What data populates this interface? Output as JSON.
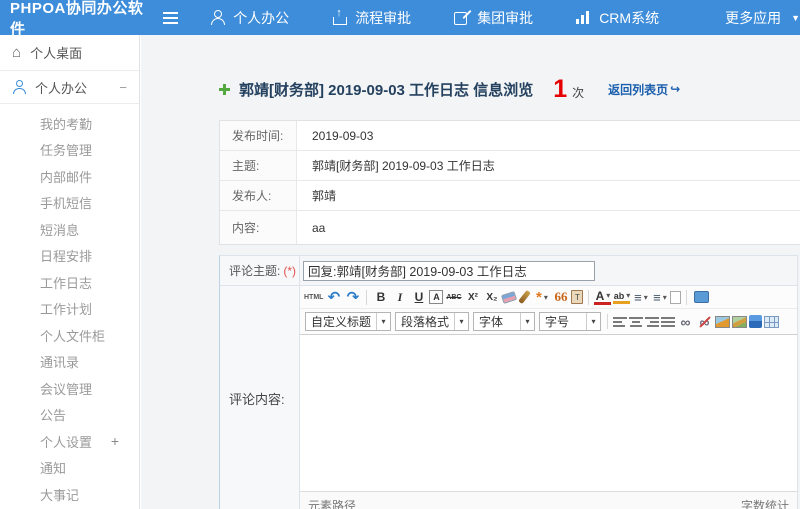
{
  "colors": {
    "topbar_blue": "#3e8dda",
    "count_red": "#e60000",
    "link_blue": "#1b5fae",
    "plus_green": "#53a93f"
  },
  "topbar": {
    "logo": "PHPOA协同办公软件",
    "nav": [
      {
        "name": "nav-item-personal-office",
        "cls": "ic-person",
        "label": "个人办公",
        "caret": ""
      },
      {
        "name": "nav-item-process-approval",
        "cls": "ic-upload",
        "label": "流程审批",
        "caret": ""
      },
      {
        "name": "nav-item-group-approval",
        "cls": "ic-edit",
        "label": "集团审批",
        "caret": ""
      },
      {
        "name": "nav-item-crm-system",
        "cls": "ic-chart",
        "label": "CRM系统",
        "caret": ""
      },
      {
        "name": "nav-item-more-apps",
        "cls": "ic-more",
        "label": "更多应用",
        "caret": "▼"
      }
    ]
  },
  "sidebar": {
    "desktop": {
      "label": "个人桌面",
      "icon": "⌂"
    },
    "section": {
      "label": "个人办公",
      "collapse": "−"
    },
    "items": [
      {
        "name": "sidebar-item-my-attendance",
        "label": "我的考勤",
        "suffix": ""
      },
      {
        "name": "sidebar-item-task-management",
        "label": "任务管理",
        "suffix": ""
      },
      {
        "name": "sidebar-item-internal-mail",
        "label": "内部邮件",
        "suffix": ""
      },
      {
        "name": "sidebar-item-mobile-sms",
        "label": "手机短信",
        "suffix": ""
      },
      {
        "name": "sidebar-item-short-message",
        "label": "短消息",
        "suffix": ""
      },
      {
        "name": "sidebar-item-schedule",
        "label": "日程安排",
        "suffix": ""
      },
      {
        "name": "sidebar-item-work-log",
        "label": "工作日志",
        "suffix": ""
      },
      {
        "name": "sidebar-item-work-plan",
        "label": "工作计划",
        "suffix": ""
      },
      {
        "name": "sidebar-item-file-cabinet",
        "label": "个人文件柜",
        "suffix": ""
      },
      {
        "name": "sidebar-item-contacts",
        "label": "通讯录",
        "suffix": ""
      },
      {
        "name": "sidebar-item-meeting-management",
        "label": "会议管理",
        "suffix": ""
      },
      {
        "name": "sidebar-item-announcement",
        "label": "公告",
        "suffix": ""
      },
      {
        "name": "sidebar-item-personal-settings",
        "label": "个人设置",
        "suffix": "+"
      },
      {
        "name": "sidebar-item-notification",
        "label": "通知",
        "suffix": ""
      },
      {
        "name": "sidebar-item-memorabilia",
        "label": "大事记",
        "suffix": ""
      }
    ]
  },
  "main": {
    "title": "郭靖[财务部] 2019-09-03 工作日志 信息浏览",
    "view_count": "1",
    "view_count_unit": "次",
    "back_link": "返回列表页",
    "back_arrow": "↪",
    "info_rows": [
      {
        "name": "info-row-publish-time",
        "label": "发布时间:",
        "value": "2019-09-03"
      },
      {
        "name": "info-row-subject",
        "label": "主题:",
        "value": "郭靖[财务部] 2019-09-03 工作日志"
      },
      {
        "name": "info-row-publisher",
        "label": "发布人:",
        "value": "郭靖"
      },
      {
        "name": "info-row-content",
        "label": "内容:",
        "value": "aa"
      }
    ],
    "comment": {
      "subject_label": "评论主题:",
      "required_mark": "(*)",
      "subject_value": "回复:郭靖[财务部] 2019-09-03 工作日志",
      "content_label": "评论内容:",
      "editor": {
        "toolbar1": [
          {
            "name": "html-source-button",
            "cls": "t-html",
            "glyph": "HTML"
          },
          {
            "name": "undo-icon",
            "cls": "t-undo",
            "glyph": "↶"
          },
          {
            "name": "redo-icon",
            "cls": "t-redo",
            "glyph": "↷"
          },
          {
            "name": "toolbar-separator",
            "cls": "t-sep",
            "it": "false"
          },
          {
            "name": "bold-icon",
            "cls": "t-bold",
            "glyph": "B"
          },
          {
            "name": "italic-icon",
            "cls": "t-italic",
            "glyph": "I"
          },
          {
            "name": "underline-icon",
            "cls": "t-underline",
            "glyph": "U"
          },
          {
            "name": "font-box-icon",
            "cls": "t-fontbox",
            "glyph": "A"
          },
          {
            "name": "strikethrough-icon",
            "cls": "t-strike",
            "glyph": "ABC"
          },
          {
            "name": "superscript-icon",
            "cls": "t-sup",
            "glyph": "X²"
          },
          {
            "name": "subscript-icon",
            "cls": "t-sub",
            "glyph": "X₂"
          },
          {
            "name": "remove-format-eraser-icon",
            "cls": "t-eraser"
          },
          {
            "name": "format-painter-brush-icon",
            "cls": "t-brush"
          },
          {
            "name": "quick-format-wand-icon",
            "cls": "t-wand has-caret",
            "glyph": "*"
          },
          {
            "name": "blockquote-icon",
            "cls": "t-quote",
            "glyph": "66"
          },
          {
            "name": "paste-icon",
            "cls": "t-paste",
            "glyph": "T"
          },
          {
            "name": "toolbar-separator",
            "cls": "t-sep",
            "it": "false"
          },
          {
            "name": "font-color-icon",
            "cls": "t-fontcolor has-caret",
            "glyph": "A"
          },
          {
            "name": "highlight-color-icon",
            "cls": "t-highlight has-caret",
            "glyph": "ab"
          },
          {
            "name": "ordered-list-icon",
            "cls": "t-ol has-caret",
            "glyph": "≡"
          },
          {
            "name": "unordered-list-icon",
            "cls": "t-ul has-caret",
            "glyph": "≡"
          },
          {
            "name": "new-page-icon",
            "cls": "t-page"
          },
          {
            "name": "toolbar-separator",
            "cls": "t-sep",
            "it": "false"
          },
          {
            "name": "fullscreen-icon",
            "cls": "t-screen"
          }
        ],
        "dropdowns": [
          {
            "name": "heading-style-select",
            "label": "自定义标题"
          },
          {
            "name": "paragraph-format-select",
            "label": "段落格式"
          },
          {
            "name": "font-family-select",
            "label": "字体"
          },
          {
            "name": "font-size-select",
            "label": "字号"
          }
        ],
        "toolbar2": [
          {
            "name": "toolbar-separator",
            "cls": "t-sep",
            "it": "false"
          },
          {
            "name": "align-left-icon",
            "cls": "t-align t-alignl"
          },
          {
            "name": "align-center-icon",
            "cls": "t-align t-alignc"
          },
          {
            "name": "align-right-icon",
            "cls": "t-align t-alignr"
          },
          {
            "name": "justify-icon",
            "cls": "t-align t-alignj"
          },
          {
            "name": "link-icon",
            "cls": "t-link",
            "glyph": "∞"
          },
          {
            "name": "unlink-icon",
            "cls": "t-unlink",
            "glyph": "∞"
          },
          {
            "name": "insert-image-icon",
            "cls": "t-img"
          },
          {
            "name": "image-gallery-icon",
            "cls": "t-img2"
          },
          {
            "name": "insert-media-icon",
            "cls": "t-media"
          },
          {
            "name": "insert-table-icon",
            "cls": "t-table"
          }
        ],
        "footer_left": "元素路径",
        "footer_right": "字数统计"
      }
    }
  }
}
